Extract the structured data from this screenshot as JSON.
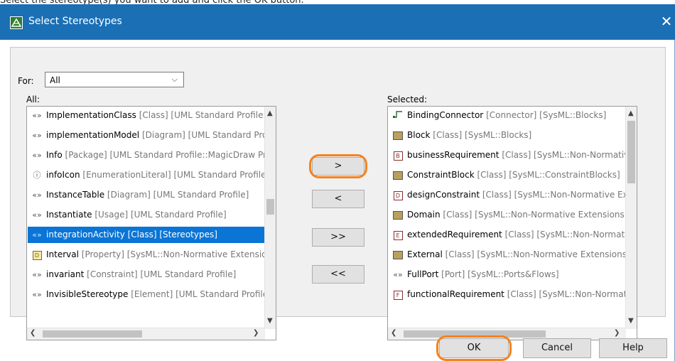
{
  "caption": "Select the stereotype(s) you want to add and click the OK button.",
  "window": {
    "title": "Select Stereotypes",
    "close_glyph": "✕"
  },
  "filter": {
    "label": "For:",
    "value": "All"
  },
  "all_list": {
    "label": "All:",
    "items": [
      {
        "icon": "stereotype",
        "name": "ImplementationClass",
        "meta": "[Class] [UML Standard Profile::UML Standard Profile]"
      },
      {
        "icon": "stereotype",
        "name": "implementationModel",
        "meta": "[Diagram] [UML Standard Profile::UML Standard Profile]"
      },
      {
        "icon": "stereotype",
        "name": "Info",
        "meta": "[Package] [UML Standard Profile::MagicDraw Profile]"
      },
      {
        "icon": "info",
        "name": "infoIcon",
        "meta": "[EnumerationLiteral] [UML Standard Profile]"
      },
      {
        "icon": "stereotype",
        "name": "InstanceTable",
        "meta": "[Diagram] [UML Standard Profile]"
      },
      {
        "icon": "stereotype",
        "name": "Instantiate",
        "meta": "[Usage] [UML Standard Profile]"
      },
      {
        "icon": "stereotype",
        "name": "integrationActivity",
        "meta": "[Class] [Stereotypes]",
        "selected": true
      },
      {
        "icon": "property",
        "name": "Interval",
        "meta": "[Property] [SysML::Non-Normative Extensions]"
      },
      {
        "icon": "stereotype",
        "name": "invariant",
        "meta": "[Constraint] [UML Standard Profile]"
      },
      {
        "icon": "stereotype",
        "name": "InvisibleStereotype",
        "meta": "[Element] [UML Standard Profile]"
      }
    ]
  },
  "selected_list": {
    "label": "Selected:",
    "items": [
      {
        "icon": "connector",
        "name": "BindingConnector",
        "meta": "[Connector] [SysML::Blocks]"
      },
      {
        "icon": "block",
        "name": "Block",
        "meta": "[Class] [SysML::Blocks]"
      },
      {
        "icon": "box-b",
        "glyph": "B",
        "name": "businessRequirement",
        "meta": "[Class] [SysML::Non-Normative Extensions]"
      },
      {
        "icon": "block",
        "name": "ConstraintBlock",
        "meta": "[Class] [SysML::ConstraintBlocks]"
      },
      {
        "icon": "box-d",
        "glyph": "D",
        "name": "designConstraint",
        "meta": "[Class] [SysML::Non-Normative Extensions]"
      },
      {
        "icon": "block",
        "name": "Domain",
        "meta": "[Class] [SysML::Non-Normative Extensions]"
      },
      {
        "icon": "box-e",
        "glyph": "E",
        "name": "extendedRequirement",
        "meta": "[Class] [SysML::Non-Normative Extensions]"
      },
      {
        "icon": "block",
        "name": "External",
        "meta": "[Class] [SysML::Non-Normative Extensions]"
      },
      {
        "icon": "stereotype",
        "name": "FullPort",
        "meta": "[Port] [SysML::Ports&Flows]"
      },
      {
        "icon": "box-f",
        "glyph": "F",
        "name": "functionalRequirement",
        "meta": "[Class] [SysML::Non-Normative Extensions]"
      }
    ]
  },
  "transfer_buttons": {
    "add": ">",
    "remove": "<",
    "add_all": ">>",
    "remove_all": "<<"
  },
  "footer": {
    "ok": "OK",
    "cancel": "Cancel",
    "help": "Help"
  },
  "glyphs": {
    "stereotype": "«»",
    "info": "ⓘ",
    "up": "▲",
    "down": "▼",
    "left": "❮",
    "right": "❯",
    "combo_arrow": "⌵"
  },
  "colors": {
    "titlebar": "#1a6fb5",
    "selection": "#0a75d6",
    "highlight_ring": "#f58220"
  }
}
